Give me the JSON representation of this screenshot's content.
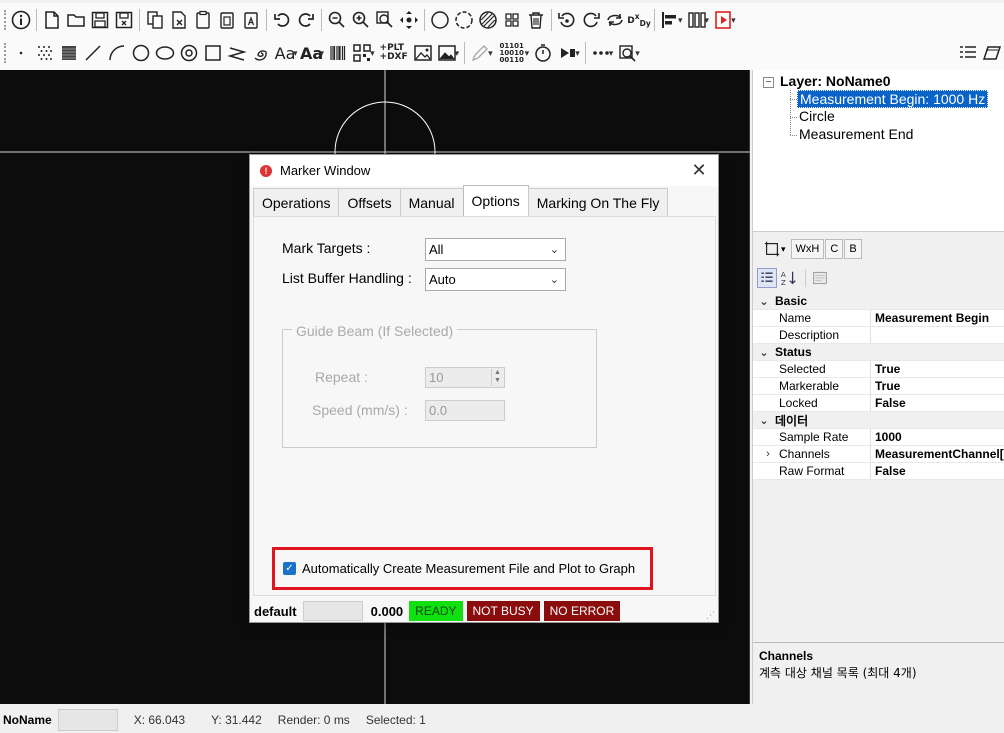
{
  "canvas_status": {
    "doc_name": "NoName",
    "x": "X: 66.043",
    "y": "Y: 31.442",
    "render": "Render: 0 ms",
    "selected": "Selected: 1"
  },
  "toolbar2": {
    "aa_label": "Aa",
    "aa_bold_label": "Aa",
    "plt_dxf": "+PLT\n+DXF",
    "binary": "01101\n10010\n00110"
  },
  "tree": {
    "layer": "Layer: NoName0",
    "items": [
      {
        "label": "Measurement Begin: 1000 Hz",
        "selected": true
      },
      {
        "label": "Circle",
        "selected": false
      },
      {
        "label": "Measurement End",
        "selected": false
      }
    ]
  },
  "prop_tools": {
    "wxh": "WxH",
    "c": "C",
    "b": "B"
  },
  "property_grid": {
    "cat_basic": "Basic",
    "name_k": "Name",
    "name_v": "Measurement Begin",
    "desc_k": "Description",
    "desc_v": "",
    "cat_status": "Status",
    "selected_k": "Selected",
    "selected_v": "True",
    "markerable_k": "Markerable",
    "markerable_v": "True",
    "locked_k": "Locked",
    "locked_v": "False",
    "cat_data": "데이터",
    "samplerate_k": "Sample Rate",
    "samplerate_v": "1000",
    "channels_k": "Channels",
    "channels_v": "MeasurementChannel[",
    "rawformat_k": "Raw Format",
    "rawformat_v": "False"
  },
  "description_panel": {
    "title": "Channels",
    "text": "계측 대상 채널 목록 (최대 4개)"
  },
  "dialog": {
    "title": "Marker Window",
    "tabs": [
      "Operations",
      "Offsets",
      "Manual",
      "Options",
      "Marking On The Fly"
    ],
    "active_tab": "Options",
    "mark_targets_label": "Mark Targets :",
    "mark_targets_value": "All",
    "list_buffer_label": "List Buffer Handling :",
    "list_buffer_value": "Auto",
    "guide_beam_legend": "Guide Beam (If Selected)",
    "repeat_label": "Repeat :",
    "repeat_value": "10",
    "speed_label": "Speed (mm/s) :",
    "speed_value": "0.0",
    "auto_create_label": "Automatically Create Measurement File and Plot to Graph",
    "auto_create_checked": true,
    "status_default": "default",
    "status_value": "0.000",
    "status_ready": "READY",
    "status_busy": "NOT BUSY",
    "status_error": "NO ERROR"
  },
  "colors": {
    "ready": "#10e010",
    "not_busy": "#8b0c0c",
    "no_error": "#8b0c0c",
    "selection": "#0a64c8",
    "highlight_border": "#e0141f"
  }
}
